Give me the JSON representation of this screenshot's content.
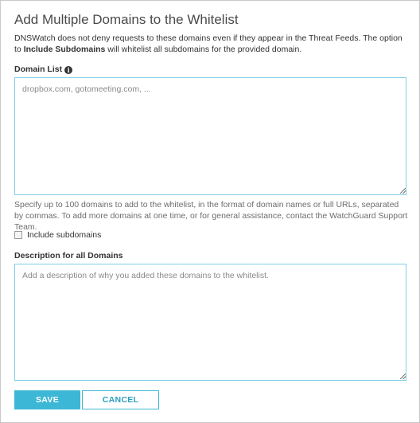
{
  "dialog": {
    "title": "Add Multiple Domains to the Whitelist",
    "intro_part1": "DNSWatch does not deny requests to these domains even if they appear in the Threat Feeds. The option to ",
    "intro_bold": "Include Subdomains",
    "intro_part2": " will whitelist all subdomains for the provided domain."
  },
  "domain_list": {
    "label": "Domain List",
    "info_icon": "info-icon",
    "placeholder": "dropbox.com, gotomeeting.com, ...",
    "value": ""
  },
  "help_text": "Specify up to 100 domains to add to the whitelist, in the format of domain names or full URLs, separated by commas. To add more domains at one time, or for general assistance, contact the WatchGuard Support Team.",
  "include_subdomains": {
    "label": "Include subdomains",
    "checked": false
  },
  "description": {
    "label": "Description for all Domains",
    "placeholder": "Add a description of why you added these domains to the whitelist.",
    "value": ""
  },
  "buttons": {
    "save": "SAVE",
    "cancel": "CANCEL"
  },
  "colors": {
    "accent": "#3cb7d6",
    "input_border": "#7fd0e6",
    "help_text": "#6d6d6d"
  }
}
